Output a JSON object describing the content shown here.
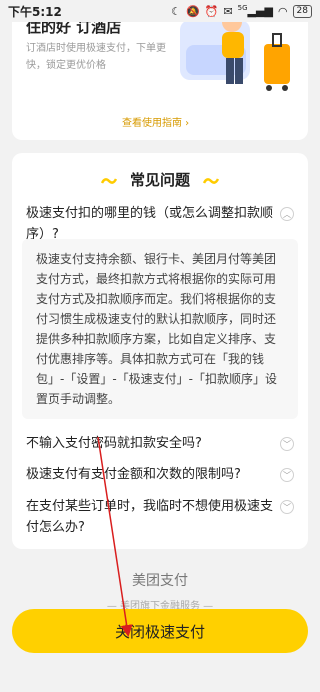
{
  "status_bar": {
    "time": "下午5:12",
    "signal_label": "5G",
    "battery": "28"
  },
  "top_card": {
    "title": "住的好 订酒店",
    "description": "订酒店时使用极速支付，下单更快，锁定更优价格",
    "guide_link": "查看使用指南 ›"
  },
  "faq": {
    "title": "常见问题",
    "items": [
      {
        "question": "极速支付扣的哪里的钱（或怎么调整扣款顺序）?",
        "expanded": true,
        "answer": "极速支付支持余额、银行卡、美团月付等美团支付方式，最终扣款方式将根据你的实际可用支付方式及扣款顺序而定。我们将根据你的支付习惯生成极速支付的默认扣款顺序，同时还提供多种扣款顺序方案，比如自定义排序、支付优惠排序等。具体扣款方式可在「我的钱包」-「设置」-「极速支付」-「扣款顺序」设置页手动调整。"
      },
      {
        "question": "不输入支付密码就扣款安全吗?",
        "expanded": false
      },
      {
        "question": "极速支付有支付金额和次数的限制吗?",
        "expanded": false
      },
      {
        "question": "在支付某些订单时，我临时不想使用极速支付怎么办?",
        "expanded": false
      }
    ]
  },
  "footer": {
    "brand": "美团支付",
    "tagline": "— 美团旗下金融服务 —"
  },
  "primary_button": {
    "label": "关闭极速支付"
  },
  "colors": {
    "accent": "#ffd000",
    "link": "#d79a00",
    "annotation_arrow": "#d91e1e"
  }
}
